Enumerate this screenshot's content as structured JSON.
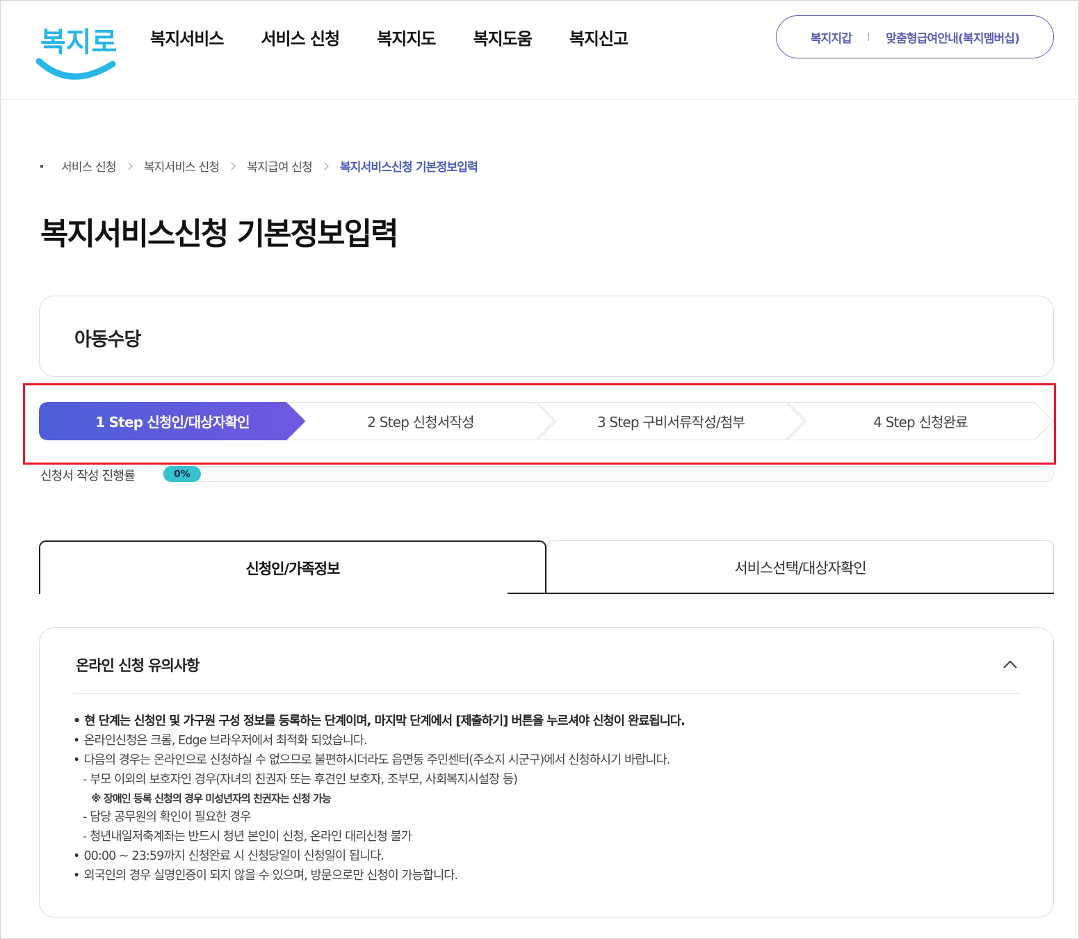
{
  "header": {
    "logo_text": "복지로",
    "nav": [
      "복지서비스",
      "서비스 신청",
      "복지지도",
      "복지도움",
      "복지신고"
    ],
    "util_links": [
      "복지지갑",
      "맞춤형급여안내(복지멤버십)"
    ]
  },
  "breadcrumb": [
    "서비스 신청",
    "복지서비스 신청",
    "복지급여 신청"
  ],
  "breadcrumb_current": "복지서비스신청 기본정보입력",
  "page_title": "복지서비스신청 기본정보입력",
  "service_name": "아동수당",
  "steps": [
    {
      "label": "1 Step 신청인/대상자확인",
      "active": true
    },
    {
      "label": "2 Step 신청서작성",
      "active": false
    },
    {
      "label": "3 Step 구비서류작성/첨부",
      "active": false
    },
    {
      "label": "4 Step 신청완료",
      "active": false
    }
  ],
  "progress": {
    "label": "신청서 작성 진행률",
    "value": 0,
    "display": "0%"
  },
  "tabs": [
    {
      "label": "신청인/가족정보",
      "active": true
    },
    {
      "label": "서비스선택/대상자확인",
      "active": false
    }
  ],
  "notice": {
    "title": "온라인 신청 유의사항",
    "lines": [
      "현 단계는 신청인 및 가구원 구성 정보를 등록하는 단계이며, 마지막 단계에서 [제출하기] 버튼을 누르셔야 신청이 완료됩니다.",
      "온라인신청은 크롬, Edge 브라우저에서 최적화 되었습니다.",
      "다음의 경우는 온라인으로 신청하실 수 없으므로 불편하시더라도 읍면동 주민센터(주소지 시군구)에서 신청하시기 바랍니다.",
      "- 부모 이외의 보호자인 경우(자녀의 친권자 또는 후견인 보호자, 조부모, 사회복지시설장 등)",
      "※ 장애인 등록 신청의 경우 미성년자의 친권자는 신청 가능",
      "- 담당 공무원의 확인이 필요한 경우",
      "- 청년내일저축계좌는 반드시 청년 본인이 신청, 온라인 대리신청 불가",
      "00:00 ~ 23:59까지 신청완료 시 신청당일이 신청일이 됩니다.",
      "외국인의 경우 실명인증이 되지 않을 수 있으며, 방문으로만 신청이 가능합니다."
    ]
  },
  "colors": {
    "accent": "#5b5fd8",
    "highlight": "#e8192c",
    "progress": "#36c2cf",
    "logo": "#29b6e8"
  }
}
